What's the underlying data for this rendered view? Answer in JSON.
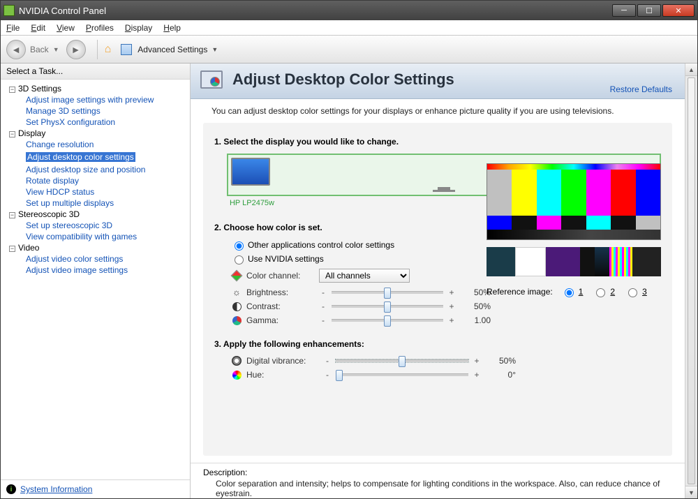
{
  "window_title": "NVIDIA Control Panel",
  "menus": {
    "file": "File",
    "edit": "Edit",
    "view": "View",
    "profiles": "Profiles",
    "display": "Display",
    "help": "Help"
  },
  "toolbar": {
    "back": "Back",
    "advanced": "Advanced Settings"
  },
  "sidebar": {
    "head": "Select a Task...",
    "g_3d": "3D Settings",
    "i_3d_1": "Adjust image settings with preview",
    "i_3d_2": "Manage 3D settings",
    "i_3d_3": "Set PhysX configuration",
    "g_disp": "Display",
    "i_d_1": "Change resolution",
    "i_d_2": "Adjust desktop color settings",
    "i_d_3": "Adjust desktop size and position",
    "i_d_4": "Rotate display",
    "i_d_5": "View HDCP status",
    "i_d_6": "Set up multiple displays",
    "g_st": "Stereoscopic 3D",
    "i_s_1": "Set up stereoscopic 3D",
    "i_s_2": "View compatibility with games",
    "g_vid": "Video",
    "i_v_1": "Adjust video color settings",
    "i_v_2": "Adjust video image settings",
    "sysinfo": "System Information"
  },
  "page": {
    "title": "Adjust Desktop Color Settings",
    "restore": "Restore Defaults",
    "sub": "You can adjust desktop color settings for your displays or enhance picture quality if you are using televisions.",
    "step1": "1. Select the display you would like to change.",
    "monitor": "HP LP2475w",
    "step2": "2. Choose how color is set.",
    "radio1": "Other applications control color settings",
    "radio2": "Use NVIDIA settings",
    "color_channel_label": "Color channel:",
    "color_channel_value": "All channels",
    "brightness_label": "Brightness:",
    "brightness_value": "50%",
    "contrast_label": "Contrast:",
    "contrast_value": "50%",
    "gamma_label": "Gamma:",
    "gamma_value": "1.00",
    "step3": "3. Apply the following enhancements:",
    "dv_label": "Digital vibrance:",
    "dv_value": "50%",
    "hue_label": "Hue:",
    "hue_value": "0°",
    "ref_label": "Reference image:",
    "ref1": "1",
    "ref2": "2",
    "ref3": "3",
    "desc_head": "Description:",
    "desc_text": "Color separation and intensity; helps to compensate for lighting conditions in the workspace. Also, can reduce chance of eyestrain."
  }
}
